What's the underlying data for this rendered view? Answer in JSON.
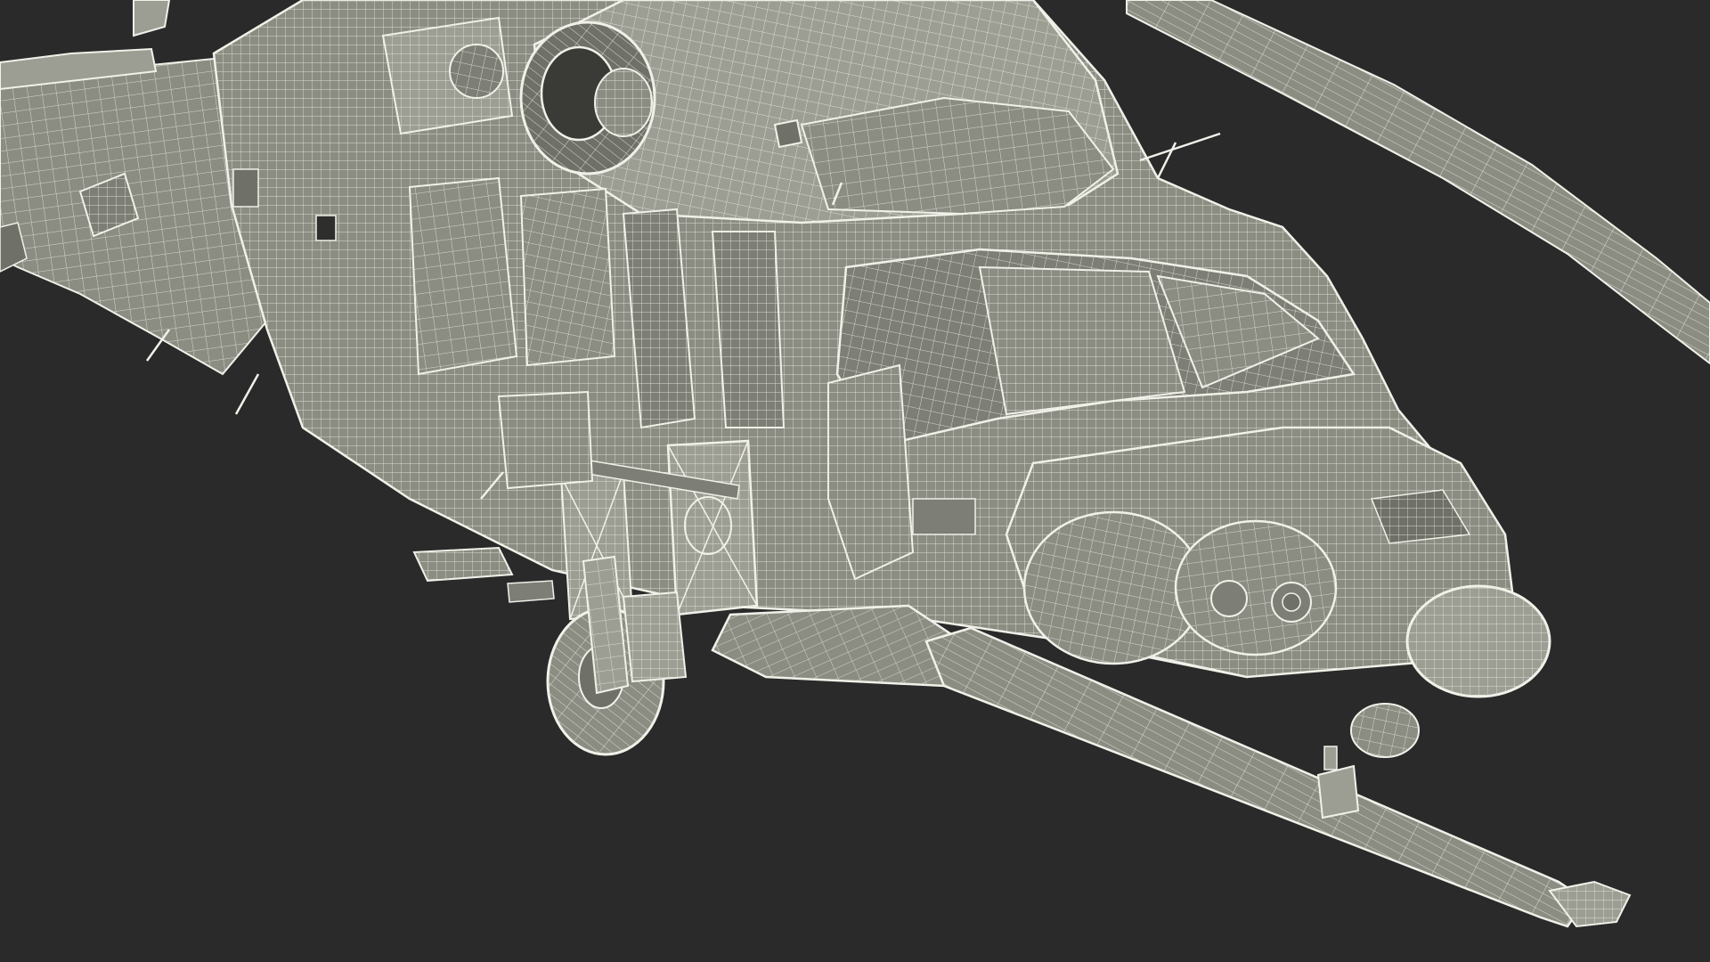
{
  "scene": {
    "subject": "helicopter-wireframe",
    "colors": {
      "background": "#2a2a2a",
      "hull": "#8b8c82",
      "hull_light": "#9d9e93",
      "hull_dark": "#6f7068",
      "mesh": "#e4e4dc",
      "outline": "#f1f1ea",
      "glass": "#7d7e75"
    }
  }
}
